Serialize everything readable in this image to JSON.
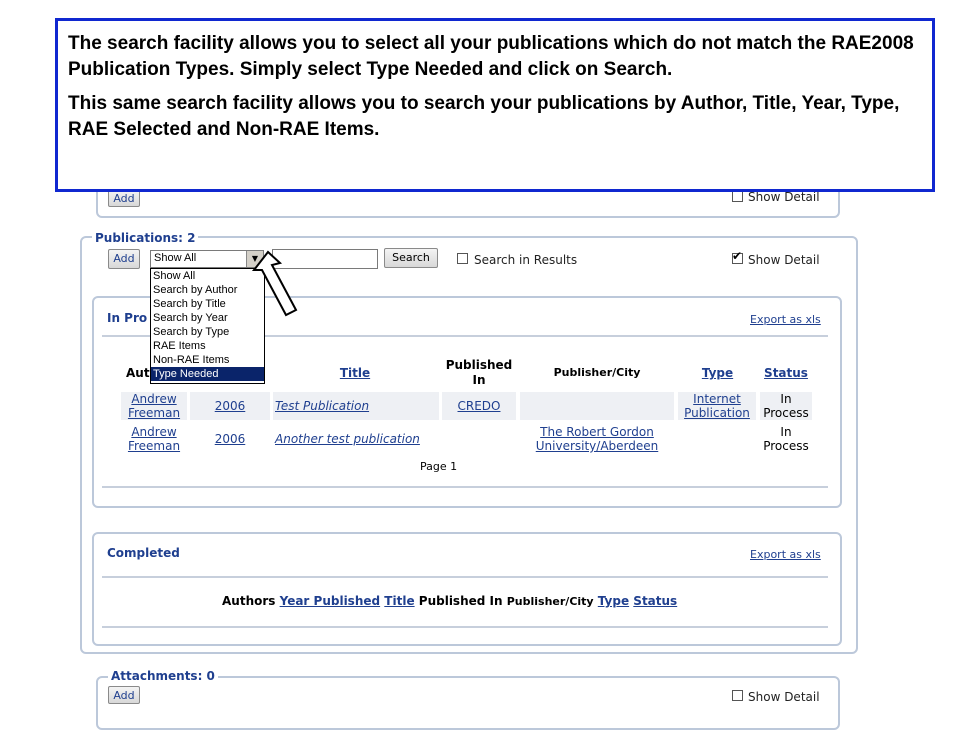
{
  "attachments_top": {
    "add_label": "Add",
    "show_detail": "Show Detail"
  },
  "publications": {
    "legend": "Publications: 2",
    "add_label": "Add",
    "select_value": "Show All",
    "search_input": "",
    "search_button": "Search",
    "search_in_results": "Search in Results",
    "show_detail": "Show Detail",
    "dropdown_options": [
      "Show All",
      "Search by Author",
      "Search by Title",
      "Search by Year",
      "Search by Type",
      "RAE Items",
      "Non-RAE Items",
      "Type Needed"
    ],
    "dropdown_selected": "Type Needed"
  },
  "in_process": {
    "heading": "In Pro",
    "export": "Export as xls",
    "headers": {
      "authors": "Aut",
      "title": "Title",
      "published_in": "Published In",
      "publisher_city": "Publisher/City",
      "type": "Type",
      "status": "Status"
    },
    "rows": [
      {
        "author": "Andrew Freeman",
        "year": "2006",
        "title": "Test Publication",
        "published_in": "CREDO",
        "publisher": "",
        "type": "Internet Publication",
        "status": "In Process"
      },
      {
        "author": "Andrew Freeman",
        "year": "2006",
        "title": "Another test publication",
        "published_in": "",
        "publisher": "The Robert Gordon University/Aberdeen",
        "type": "",
        "status": "In Process"
      }
    ],
    "page": "Page 1"
  },
  "completed": {
    "heading": "Completed",
    "export": "Export as xls",
    "headers": {
      "authors": "Authors",
      "year": "Year Published",
      "title": "Title",
      "published_in": "Published In",
      "publisher_city": "Publisher/City",
      "type": "Type",
      "status": "Status"
    }
  },
  "attachments": {
    "legend": "Attachments: 0",
    "add_label": "Add",
    "show_detail": "Show Detail"
  },
  "note": {
    "p1": "The search facility allows you to select all your publications which do not match the RAE2008 Publication Types.   Simply select Type Needed and click on Search.",
    "p2": "This same search facility allows you to search your publications by Author, Title, Year, Type, RAE Selected and Non-RAE Items."
  },
  "colors": {
    "note_border": "#1028d0",
    "link": "#1f3f8f",
    "panel_border": "#bcc8da",
    "selected_option": "#0a246a"
  }
}
